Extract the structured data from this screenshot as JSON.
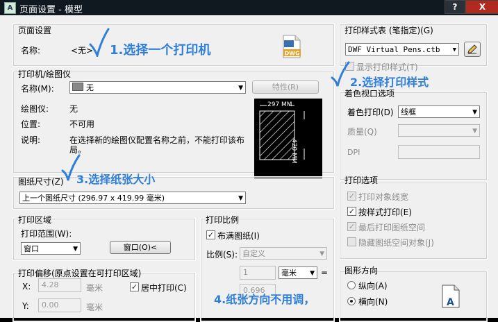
{
  "window": {
    "title": "页面设置 - 模型",
    "help_label": "?",
    "close_label": "X",
    "app_icon": "A"
  },
  "page_setup": {
    "section_label": "页面设置",
    "name_label": "名称:",
    "name_value": "<无>"
  },
  "printer": {
    "section_label": "打印机/绘图仪",
    "name_label": "名称(M):",
    "name_value": "无",
    "properties_button": "特性(R)",
    "plotter_label": "绘图仪:",
    "plotter_value": "无",
    "location_label": "位置:",
    "location_value": "不可用",
    "desc_label": "说明:",
    "desc_value_line1": "在选择新的绘图仪配置名称之前，不能打印该布",
    "desc_value_line2": "局。"
  },
  "preview": {
    "width_label": "297 MM",
    "height_label": "420 MM"
  },
  "paper": {
    "section_label": "图纸尺寸(Z)",
    "value": "上一个图纸尺寸 (296.97 x 419.99 毫米)"
  },
  "plot_area": {
    "section_label": "打印区域",
    "range_label": "打印范围(W):",
    "range_value": "窗口",
    "window_button": "窗口(O)<"
  },
  "plot_offset": {
    "section_label": "打印偏移(原点设置在可打印区域)",
    "x_label": "X:",
    "x_value": "4.28",
    "x_unit": "毫米",
    "center_label": "居中打印(C)",
    "y_label": "Y:",
    "y_value": "0.00",
    "y_unit": "毫米"
  },
  "plot_scale": {
    "section_label": "打印比例",
    "fit_label": "布满图纸(I)",
    "scale_label": "比例(S):",
    "scale_value": "自定义",
    "num_value": "1",
    "unit_value": "毫米",
    "equals": "=",
    "units_value": "0.696"
  },
  "plot_style": {
    "section_label": "打印样式表 (笔指定)(G)",
    "value": "DWF Virtual Pens.ctb",
    "show_label": "显示打印样式(T)"
  },
  "shaded": {
    "section_label": "着色视口选项",
    "shade_label": "着色打印(D)",
    "shade_value": "线框",
    "quality_label": "质量(Q)",
    "dpi_label": "DPI"
  },
  "plot_options": {
    "section_label": "打印选项",
    "items": [
      {
        "label": "打印对象线宽",
        "checked": true,
        "disabled": true
      },
      {
        "label": "按样式打印(E)",
        "checked": true,
        "disabled": false
      },
      {
        "label": "最后打印图纸空间",
        "checked": true,
        "disabled": true
      },
      {
        "label": "隐藏图纸空间对象(J)",
        "checked": false,
        "disabled": true
      }
    ]
  },
  "orientation": {
    "section_label": "图形方向",
    "portrait_label": "纵向(A)",
    "landscape_label": "横向(N)",
    "selected": "landscape",
    "icon_letter": "A"
  },
  "annotations": {
    "a1": "1.选择一个打印机",
    "a2": "2.选择打印样式",
    "a3": "3.选择纸张大小",
    "a4": "4.纸张方向不用调，"
  },
  "colors": {
    "annotation": "#2f7fd8",
    "titlebar": "#101820",
    "close": "#b02a20"
  }
}
